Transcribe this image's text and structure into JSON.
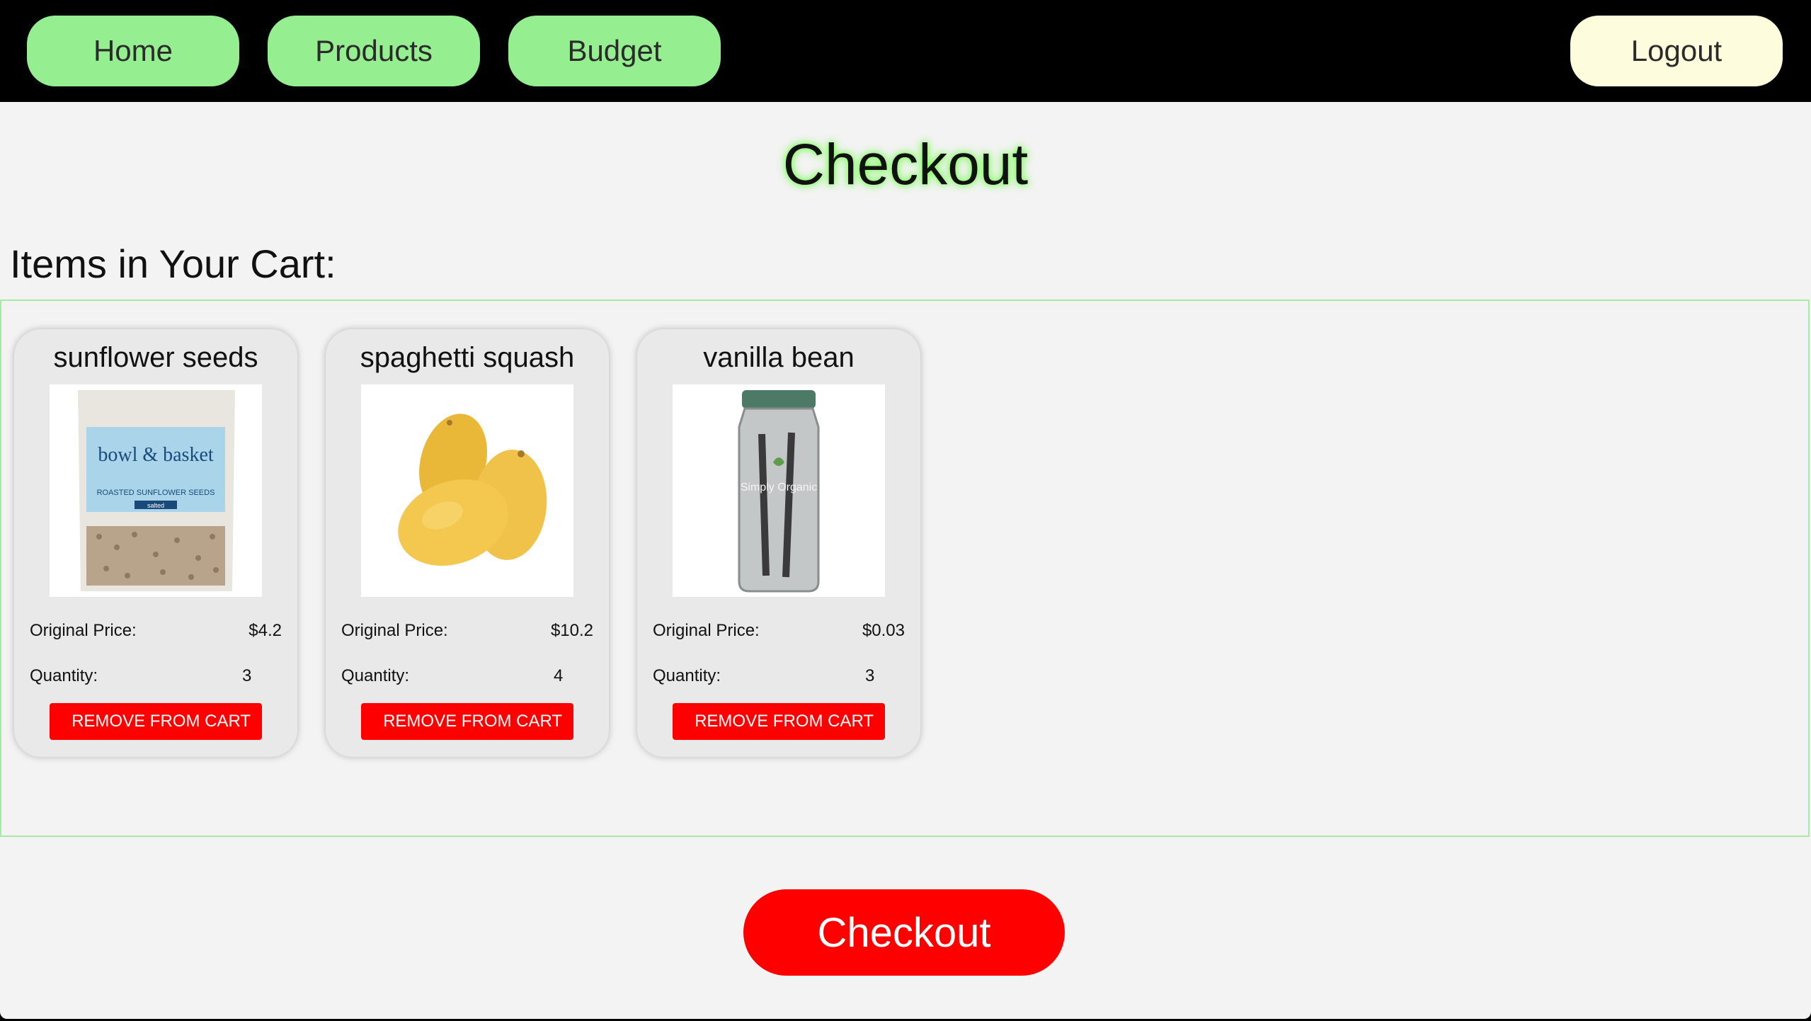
{
  "nav": {
    "home": "Home",
    "products": "Products",
    "budget": "Budget",
    "logout": "Logout"
  },
  "page": {
    "title": "Checkout",
    "cart_heading": "Items in Your Cart:",
    "checkout_label": "Checkout"
  },
  "colors": {
    "nav_button": "#95ef90",
    "logout_button": "#fdfcdc",
    "remove_button": "#ff0000",
    "checkout_button": "#ff0000",
    "title_glow": "#7dfc5a"
  },
  "cart": {
    "price_label": "Original Price:",
    "quantity_label": "Quantity:",
    "remove_label": "REMOVE FROM CART",
    "items": [
      {
        "name": "sunflower seeds",
        "price": "$4.2",
        "quantity": "3",
        "image": "sunflower-seeds-bag",
        "image_brand": "bowl & basket",
        "image_product": "ROASTED SUNFLOWER SEEDS",
        "image_variant": "salted"
      },
      {
        "name": "spaghetti squash",
        "price": "$10.2",
        "quantity": "4",
        "image": "spaghetti-squash"
      },
      {
        "name": "vanilla bean",
        "price": "$0.03",
        "quantity": "3",
        "image": "vanilla-bean-jar",
        "image_brand": "Simply Organic"
      }
    ]
  }
}
